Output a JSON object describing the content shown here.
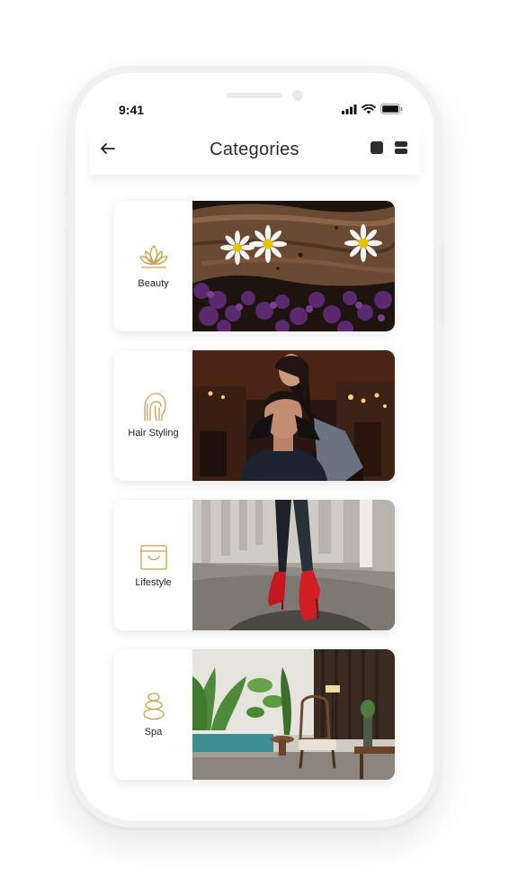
{
  "status_bar": {
    "time": "9:41"
  },
  "header": {
    "title": "Categories"
  },
  "icons": {
    "back": "arrow-left-icon",
    "view_single": "grid-single-view-icon",
    "view_list": "list-view-icon"
  },
  "accent_color": "#c9a24a",
  "categories": [
    {
      "label": "Beauty",
      "icon": "lotus-icon"
    },
    {
      "label": "Hair Styling",
      "icon": "hair-head-icon"
    },
    {
      "label": "Lifestyle",
      "icon": "shopping-bag-icon"
    },
    {
      "label": "Spa",
      "icon": "stacked-stones-icon"
    }
  ]
}
